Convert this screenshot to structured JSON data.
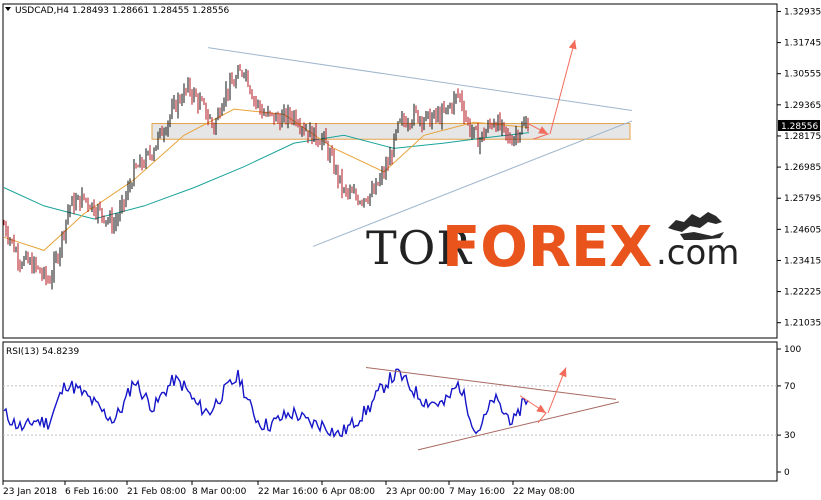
{
  "chart_data": [
    {
      "type": "candlestick",
      "title": "USDCAD,H4  1.28493 1.28661 1.28455 1.28556",
      "ylim": [
        1.2045,
        1.3322
      ],
      "y_ticks": [
        "1.32935",
        "1.31745",
        "1.30555",
        "1.29365",
        "1.28175",
        "1.26985",
        "1.25795",
        "1.24605",
        "1.23415",
        "1.22225",
        "1.21035"
      ],
      "x_ticks": [
        "23 Jan 2018",
        "6 Feb 16:00",
        "21 Feb 08:00",
        "8 Mar 00:00",
        "22 Mar 16:00",
        "6 Apr 08:00",
        "23 Apr 00:00",
        "7 May 16:00",
        "22 May 08:00"
      ],
      "last_price": "1.28556",
      "price_path": [
        [
          0,
          1.248
        ],
        [
          15,
          1.235
        ],
        [
          30,
          1.232
        ],
        [
          45,
          1.226
        ],
        [
          55,
          1.238
        ],
        [
          65,
          1.255
        ],
        [
          80,
          1.258
        ],
        [
          95,
          1.253
        ],
        [
          110,
          1.248
        ],
        [
          120,
          1.256
        ],
        [
          130,
          1.268
        ],
        [
          145,
          1.274
        ],
        [
          160,
          1.285
        ],
        [
          175,
          1.296
        ],
        [
          185,
          1.3
        ],
        [
          200,
          1.292
        ],
        [
          210,
          1.285
        ],
        [
          220,
          1.298
        ],
        [
          230,
          1.302
        ],
        [
          240,
          1.308
        ],
        [
          250,
          1.296
        ],
        [
          260,
          1.29
        ],
        [
          275,
          1.288
        ],
        [
          290,
          1.29
        ],
        [
          305,
          1.283
        ],
        [
          320,
          1.28
        ],
        [
          330,
          1.27
        ],
        [
          340,
          1.26
        ],
        [
          355,
          1.258
        ],
        [
          370,
          1.26
        ],
        [
          385,
          1.272
        ],
        [
          395,
          1.286
        ],
        [
          410,
          1.29
        ],
        [
          425,
          1.288
        ],
        [
          440,
          1.29
        ],
        [
          455,
          1.298
        ],
        [
          465,
          1.285
        ],
        [
          475,
          1.28
        ],
        [
          490,
          1.288
        ],
        [
          505,
          1.28
        ],
        [
          515,
          1.284
        ],
        [
          525,
          1.287
        ]
      ],
      "series": [
        {
          "color": "#1aa39a",
          "values": [
            [
              0,
              1.262
            ],
            [
              40,
              1.255
            ],
            [
              90,
              1.25
            ],
            [
              140,
              1.255
            ],
            [
              190,
              1.262
            ],
            [
              240,
              1.27
            ],
            [
              290,
              1.279
            ],
            [
              340,
              1.282
            ],
            [
              390,
              1.277
            ],
            [
              440,
              1.279
            ],
            [
              480,
              1.281
            ],
            [
              525,
              1.283
            ]
          ]
        },
        {
          "color": "#e8a33a",
          "values": [
            [
              0,
              1.243
            ],
            [
              40,
              1.238
            ],
            [
              80,
              1.252
            ],
            [
              130,
              1.265
            ],
            [
              180,
              1.282
            ],
            [
              230,
              1.292
            ],
            [
              280,
              1.29
            ],
            [
              330,
              1.277
            ],
            [
              380,
              1.268
            ],
            [
              420,
              1.282
            ],
            [
              470,
              1.287
            ],
            [
              525,
              1.285
            ]
          ]
        }
      ],
      "zone": {
        "y": [
          1.2805,
          1.2865
        ],
        "x": [
          152,
          630
        ]
      },
      "trendlines": [
        {
          "color": "#9fb6cc",
          "points": [
            [
              208,
              1.3155
            ],
            [
              632,
              1.2915
            ]
          ]
        },
        {
          "color": "#9fb6cc",
          "points": [
            [
              313,
              1.2395
            ],
            [
              632,
              1.2875
            ]
          ]
        },
        {
          "color": "#f26b5b",
          "points": [
            [
              528,
              1.2865
            ],
            [
              548,
              1.2825
            ],
            [
              533,
              1.2805
            ]
          ]
        },
        {
          "color": "#f26b5b",
          "points": [
            [
              550,
              1.2825
            ],
            [
              575,
              1.3185
            ]
          ]
        }
      ]
    },
    {
      "type": "line",
      "title": "RSI(13) 54.8239",
      "ylim": [
        0,
        100
      ],
      "y_ticks": [
        "100",
        "70",
        "30",
        "0"
      ],
      "levels": [
        70,
        30
      ],
      "rsi_path": [
        [
          0,
          48
        ],
        [
          10,
          40
        ],
        [
          20,
          35
        ],
        [
          30,
          42
        ],
        [
          45,
          40
        ],
        [
          55,
          60
        ],
        [
          62,
          72
        ],
        [
          72,
          68
        ],
        [
          85,
          60
        ],
        [
          100,
          48
        ],
        [
          110,
          42
        ],
        [
          120,
          55
        ],
        [
          130,
          75
        ],
        [
          140,
          62
        ],
        [
          150,
          52
        ],
        [
          160,
          65
        ],
        [
          170,
          75
        ],
        [
          180,
          70
        ],
        [
          192,
          55
        ],
        [
          205,
          48
        ],
        [
          215,
          60
        ],
        [
          225,
          70
        ],
        [
          235,
          78
        ],
        [
          245,
          55
        ],
        [
          255,
          40
        ],
        [
          265,
          38
        ],
        [
          280,
          45
        ],
        [
          290,
          48
        ],
        [
          305,
          40
        ],
        [
          320,
          38
        ],
        [
          335,
          30
        ],
        [
          350,
          40
        ],
        [
          365,
          52
        ],
        [
          375,
          65
        ],
        [
          385,
          75
        ],
        [
          395,
          80
        ],
        [
          405,
          70
        ],
        [
          420,
          58
        ],
        [
          440,
          55
        ],
        [
          455,
          72
        ],
        [
          465,
          50
        ],
        [
          472,
          32
        ],
        [
          480,
          42
        ],
        [
          490,
          60
        ],
        [
          500,
          48
        ],
        [
          512,
          40
        ],
        [
          520,
          62
        ],
        [
          525,
          55
        ]
      ],
      "series": [
        {
          "color": "#1414c8",
          "values": []
        }
      ],
      "trendlines": [
        {
          "color": "#a86a62",
          "points": [
            [
              366,
              85
            ],
            [
              616,
              59
            ]
          ]
        },
        {
          "color": "#a86a62",
          "points": [
            [
              418,
              18
            ],
            [
              619,
              57
            ]
          ]
        },
        {
          "color": "#f26b5b",
          "points": [
            [
              520,
              62
            ],
            [
              546,
              48
            ],
            [
              538,
              40
            ]
          ]
        },
        {
          "color": "#f26b5b",
          "points": [
            [
              548,
              48
            ],
            [
              566,
              85
            ]
          ]
        }
      ]
    }
  ],
  "watermark": {
    "part1": "TOR",
    "part2": "FOREX",
    "part3": ".com"
  }
}
